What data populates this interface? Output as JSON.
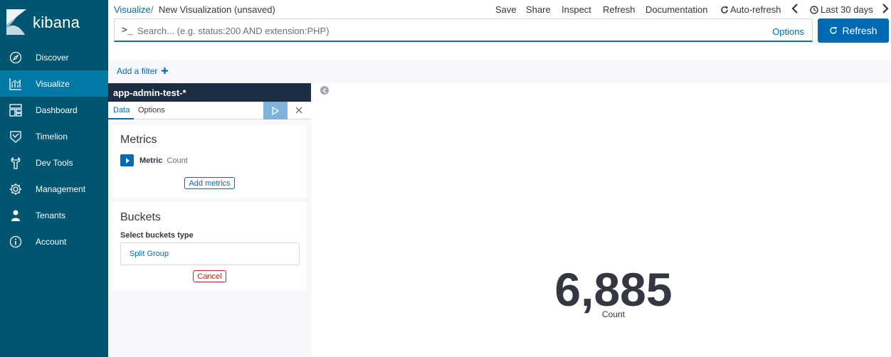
{
  "app": {
    "name": "kibana"
  },
  "sidebar": {
    "items": [
      {
        "label": "Discover",
        "icon": "compass-icon"
      },
      {
        "label": "Visualize",
        "icon": "chart-icon",
        "active": true
      },
      {
        "label": "Dashboard",
        "icon": "dashboard-icon"
      },
      {
        "label": "Timelion",
        "icon": "timelion-icon"
      },
      {
        "label": "Dev Tools",
        "icon": "wrench-icon"
      },
      {
        "label": "Management",
        "icon": "gear-icon"
      },
      {
        "label": "Tenants",
        "icon": "user-icon"
      },
      {
        "label": "Account",
        "icon": "info-icon"
      }
    ]
  },
  "breadcrumb": {
    "root": "Visualize",
    "separator": "/",
    "current": "New Visualization (unsaved)"
  },
  "topnav": {
    "save": "Save",
    "share": "Share",
    "inspect": "Inspect",
    "refresh": "Refresh",
    "documentation": "Documentation",
    "auto_refresh": "Auto-refresh",
    "time_range": "Last 30 days"
  },
  "query": {
    "prompt": ">_",
    "placeholder": "Search... (e.g. status:200 AND extension:PHP)",
    "value": "",
    "options": "Options"
  },
  "refresh_button": "Refresh",
  "filter": {
    "add_label": "Add a filter"
  },
  "editor": {
    "index_pattern": "app-admin-test-*",
    "tabs": {
      "data": "Data",
      "options": "Options"
    },
    "metrics": {
      "title": "Metrics",
      "metric_label": "Metric",
      "metric_type": "Count",
      "add_button": "Add metrics"
    },
    "buckets": {
      "title": "Buckets",
      "select_label": "Select buckets type",
      "option": "Split Group",
      "cancel": "Cancel"
    }
  },
  "visualization": {
    "value": "6,885",
    "label": "Count"
  },
  "colors": {
    "sidebar": "#005571",
    "sidebar_active": "#0079a5",
    "primary": "#006bb4",
    "index_header": "#1d2e44",
    "danger": "#bd271e"
  }
}
